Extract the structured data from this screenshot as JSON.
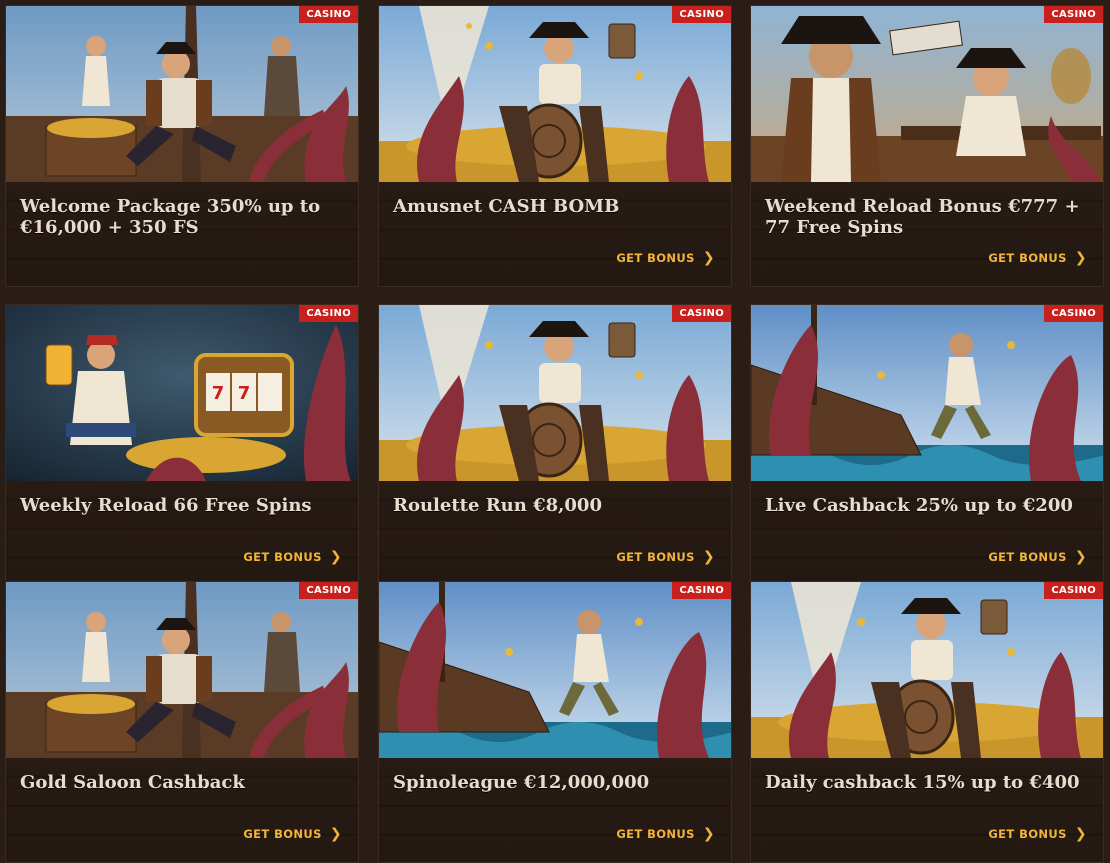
{
  "badge_label": "CASINO",
  "cta_label": "GET BONUS",
  "colors": {
    "accent": "#f3b43c",
    "badge": "#c8201c",
    "card_bg": "#2c1f18",
    "title": "#e8dccf"
  },
  "promotions": [
    {
      "title": "Welcome Package 350% up to €16,000 + 350 FS",
      "art": "captain-throne",
      "show_cta": false
    },
    {
      "title": "Amusnet CASH BOMB",
      "art": "barrel-pirate",
      "show_cta": true
    },
    {
      "title": "Weekend Reload Bonus €777 + 77 Free Spins",
      "art": "pirate-duo",
      "show_cta": true
    },
    {
      "title": "Weekly Reload 66 Free Spins",
      "art": "slot-pirate",
      "show_cta": true
    },
    {
      "title": "Roulette Run €8,000",
      "art": "barrel-pirate",
      "show_cta": true
    },
    {
      "title": "Live Cashback 25% up to €200",
      "art": "kraken-ship",
      "show_cta": true
    },
    {
      "title": "Gold Saloon Cashback",
      "art": "captain-throne",
      "show_cta": true
    },
    {
      "title": "Spinoleague €12,000,000",
      "art": "kraken-ship",
      "show_cta": true
    },
    {
      "title": "Daily cashback 15% up to €400",
      "art": "barrel-pirate",
      "show_cta": true
    }
  ]
}
